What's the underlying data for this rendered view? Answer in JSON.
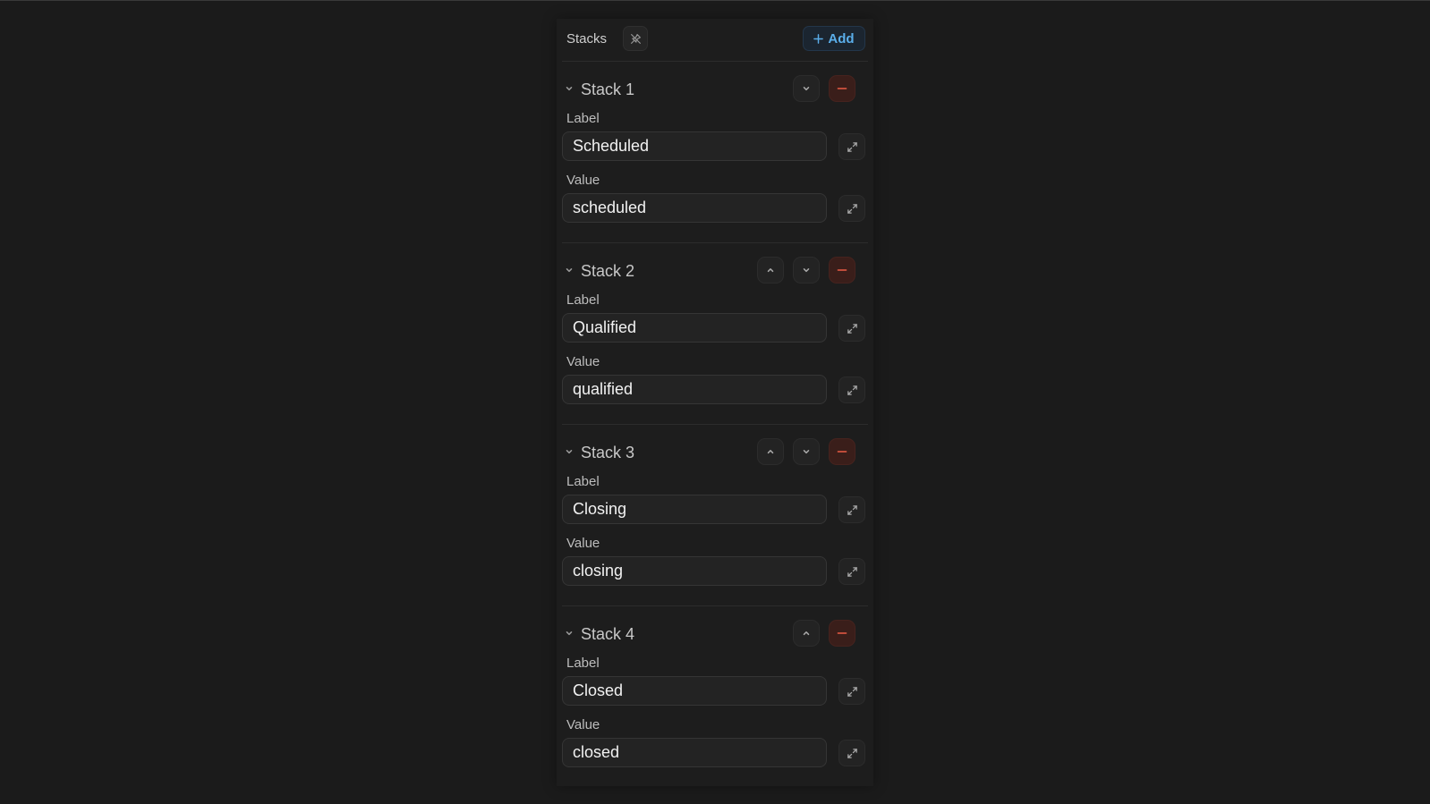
{
  "header": {
    "title": "Stacks",
    "pin_icon": "pin-off-icon",
    "add_label": "Add",
    "add_icon": "plus-icon"
  },
  "field_labels": {
    "label": "Label",
    "value": "Value"
  },
  "stacks": [
    {
      "title": "Stack 1",
      "label": "Scheduled",
      "value": "scheduled",
      "can_move_up": false,
      "can_move_down": true
    },
    {
      "title": "Stack 2",
      "label": "Qualified",
      "value": "qualified",
      "can_move_up": true,
      "can_move_down": true
    },
    {
      "title": "Stack 3",
      "label": "Closing",
      "value": "closing",
      "can_move_up": true,
      "can_move_down": true
    },
    {
      "title": "Stack 4",
      "label": "Closed",
      "value": "closed",
      "can_move_up": true,
      "can_move_down": false
    }
  ],
  "colors": {
    "background": "#1b1b1b",
    "accent": "#5aaeea",
    "danger": "#d2533f",
    "text": "#f2f2f2"
  }
}
